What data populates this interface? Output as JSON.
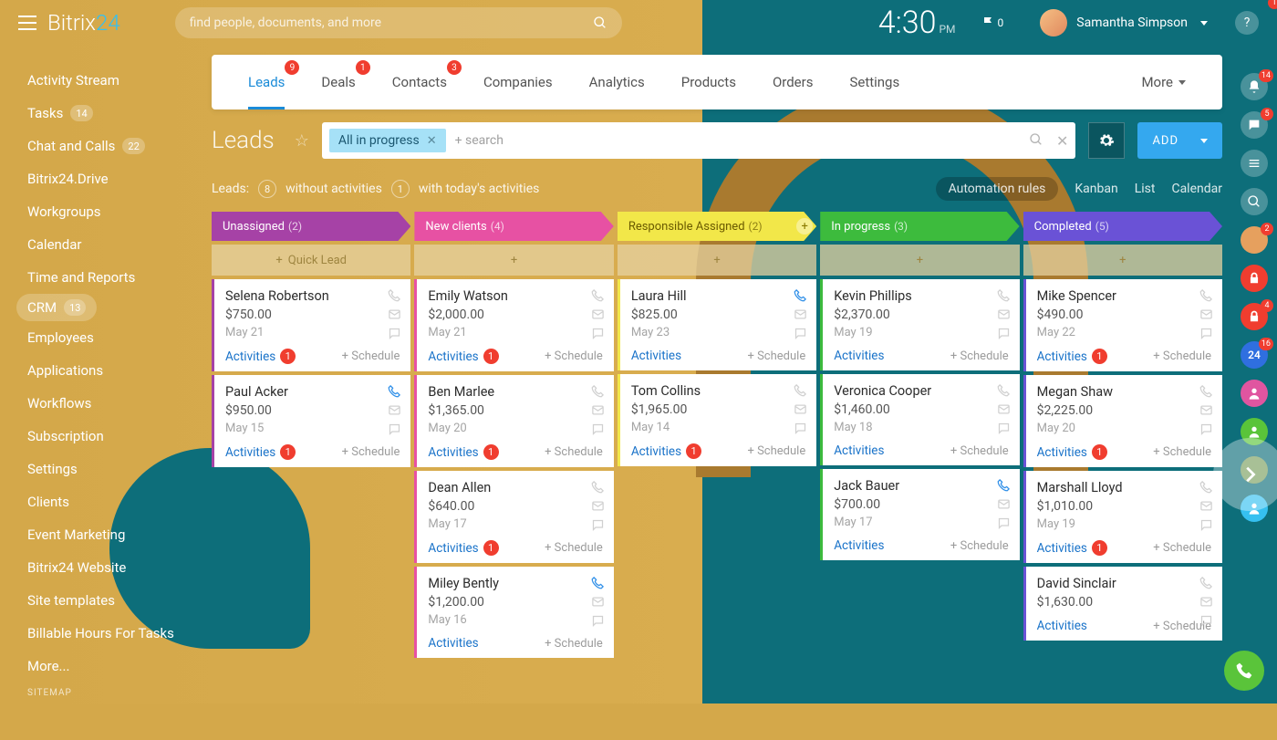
{
  "logo": {
    "part1": "Bitrix",
    "part2": "24"
  },
  "search": {
    "placeholder": "find people, documents, and more"
  },
  "clock": {
    "time": "4:30",
    "ampm": "PM"
  },
  "flag": {
    "count": "0"
  },
  "user": {
    "name": "Samantha Simpson"
  },
  "help_badge": "1",
  "sidebar": {
    "items": [
      {
        "label": "Activity Stream"
      },
      {
        "label": "Tasks",
        "badge": "14"
      },
      {
        "label": "Chat and Calls",
        "badge": "22"
      },
      {
        "label": "Bitrix24.Drive"
      },
      {
        "label": "Workgroups"
      },
      {
        "label": "Calendar"
      },
      {
        "label": "Time and Reports"
      },
      {
        "label": "CRM",
        "badge": "13",
        "active": true
      },
      {
        "label": "Employees"
      },
      {
        "label": "Applications"
      },
      {
        "label": "Workflows"
      },
      {
        "label": "Subscription"
      },
      {
        "label": "Settings"
      },
      {
        "label": "Clients"
      },
      {
        "label": "Event Marketing"
      },
      {
        "label": "Bitrix24 Website"
      },
      {
        "label": "Site templates"
      },
      {
        "label": "Billable Hours For Tasks"
      },
      {
        "label": "More..."
      }
    ],
    "sitemap": "SITEMAP"
  },
  "tabs": [
    {
      "label": "Leads",
      "badge": "9"
    },
    {
      "label": "Deals",
      "badge": "1"
    },
    {
      "label": "Contacts",
      "badge": "3"
    },
    {
      "label": "Companies"
    },
    {
      "label": "Analytics"
    },
    {
      "label": "Products"
    },
    {
      "label": "Orders"
    },
    {
      "label": "Settings"
    }
  ],
  "tabs_more": "More",
  "page": {
    "title": "Leads"
  },
  "filter": {
    "chip": "All in progress",
    "plus_search": "+ search"
  },
  "add_button": "ADD",
  "subbar": {
    "label": "Leads:",
    "without_count": "8",
    "without_label": "without activities",
    "with_count": "1",
    "with_label": "with today's activities"
  },
  "views": {
    "auto": "Automation rules",
    "kanban": "Kanban",
    "list": "List",
    "calendar": "Calendar"
  },
  "quick_lead": "Quick Lead",
  "activities_label": "Activities",
  "schedule_label": "+ Schedule",
  "columns": [
    {
      "title": "Unassigned",
      "count": "(2)",
      "color": "c0",
      "cards": [
        {
          "name": "Selena Robertson",
          "amount": "$750.00",
          "date": "May 21",
          "act_badge": "1"
        },
        {
          "name": "Paul Acker",
          "amount": "$950.00",
          "date": "May 15",
          "act_badge": "1",
          "hot": true
        }
      ]
    },
    {
      "title": "New clients",
      "count": "(4)",
      "color": "c1",
      "cards": [
        {
          "name": "Emily Watson",
          "amount": "$2,000.00",
          "date": "May 21",
          "act_badge": "1"
        },
        {
          "name": "Ben Marlee",
          "amount": "$1,365.00",
          "date": "May 20",
          "act_badge": "1"
        },
        {
          "name": "Dean Allen",
          "amount": "$640.00",
          "date": "May 17",
          "act_badge": "1"
        },
        {
          "name": "Miley Bently",
          "amount": "$1,200.00",
          "date": "May 16",
          "hot": true
        }
      ]
    },
    {
      "title": "Responsible Assigned",
      "count": "(2)",
      "color": "c2",
      "showplus": true,
      "cards": [
        {
          "name": "Laura Hill",
          "amount": "$825.00",
          "date": "May 23",
          "hot": true
        },
        {
          "name": "Tom Collins",
          "amount": "$1,965.00",
          "date": "May 14",
          "act_badge": "1"
        }
      ]
    },
    {
      "title": "In progress",
      "count": "(3)",
      "color": "c3",
      "cards": [
        {
          "name": "Kevin Phillips",
          "amount": "$2,370.00",
          "date": "May 19"
        },
        {
          "name": "Veronica Cooper",
          "amount": "$1,460.00",
          "date": "May 18"
        },
        {
          "name": "Jack Bauer",
          "amount": "$700.00",
          "date": "May 17",
          "hot": true
        }
      ]
    },
    {
      "title": "Completed",
      "count": "(5)",
      "color": "c4",
      "cards": [
        {
          "name": "Mike Spencer",
          "amount": "$490.00",
          "date": "May 22",
          "act_badge": "1"
        },
        {
          "name": "Megan Shaw",
          "amount": "$2,225.00",
          "date": "May 20",
          "act_badge": "1"
        },
        {
          "name": "Marshall Lloyd",
          "amount": "$1,010.00",
          "date": "May 19",
          "act_badge": "1"
        },
        {
          "name": "David Sinclair",
          "amount": "$1,630.00"
        }
      ]
    }
  ],
  "rightrail": [
    {
      "bg": "rgba(255,255,255,.25)",
      "icon": "bell",
      "badge": "14"
    },
    {
      "bg": "rgba(255,255,255,.25)",
      "icon": "chat",
      "badge": "5"
    },
    {
      "bg": "rgba(255,255,255,.25)",
      "icon": "lines"
    },
    {
      "bg": "rgba(255,255,255,.25)",
      "icon": "search"
    },
    {
      "bg": "#e6a05e",
      "icon": "avatar",
      "badge": "2"
    },
    {
      "bg": "#f03d2f",
      "icon": "lock"
    },
    {
      "bg": "#f03d2f",
      "icon": "lock",
      "badge": "4"
    },
    {
      "bg": "#2f6fe0",
      "text": "24",
      "badge": "16"
    },
    {
      "bg": "#e055a0",
      "icon": "person"
    },
    {
      "bg": "#5ac43a",
      "icon": "person"
    },
    {
      "bg": "#7a9e5e",
      "icon": "avatar"
    },
    {
      "bg": "#35c0f0",
      "icon": "person"
    }
  ]
}
